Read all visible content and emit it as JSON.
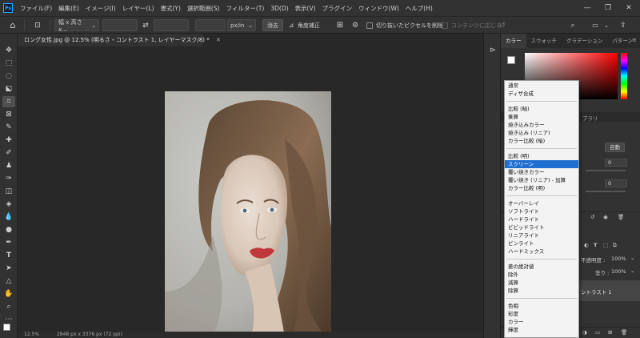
{
  "menubar": {
    "items": [
      "ファイル(F)",
      "編集(E)",
      "イメージ(I)",
      "レイヤー(L)",
      "書式(Y)",
      "選択範囲(S)",
      "フィルター(T)",
      "3D(D)",
      "表示(V)",
      "プラグイン",
      "ウィンドウ(W)",
      "ヘルプ(H)"
    ]
  },
  "optionsbar": {
    "ratio_value": "幅 x 高さ x...",
    "unit_value": "px/in",
    "clear_label": "消去",
    "straighten_label": "角度補正",
    "delete_cropped_label": "切り抜いたピクセルを削除",
    "content_aware_label": "コンテンツに応じる"
  },
  "document": {
    "tab_title": "ロング女性.jpg @ 12.5% (明るさ・コントラスト 1, レイヤーマスク/8) *"
  },
  "statusbar": {
    "zoom": "12.5%",
    "info": "2848 px x 3376 px (72 ppi)"
  },
  "panels": {
    "tabs": [
      "カラー",
      "スウォッチ",
      "グラデーション",
      "パターン"
    ],
    "adjust_tab_partial": "ブラリ",
    "auto_label": "自動",
    "value_1": "0",
    "value_2": "0",
    "opacity_label": "不透明度 :",
    "opacity_value": "100%",
    "fill_label": "塗り :",
    "fill_value": "100%",
    "layer_name_partial": "ントラスト 1"
  },
  "blend_modes": {
    "groups": [
      [
        "通常",
        "ディザ合成"
      ],
      [
        "比較 (暗)",
        "乗算",
        "焼き込みカラー",
        "焼き込み (リニア)",
        "カラー比較 (暗)"
      ],
      [
        "比較 (明)",
        "スクリーン",
        "覆い焼きカラー",
        "覆い焼き (リニア) - 加算",
        "カラー比較 (明)"
      ],
      [
        "オーバーレイ",
        "ソフトライト",
        "ハードライト",
        "ビビッドライト",
        "リニアライト",
        "ピンライト",
        "ハードミックス"
      ],
      [
        "差の絶対値",
        "除外",
        "減算",
        "除算"
      ],
      [
        "色相",
        "彩度",
        "カラー",
        "輝度"
      ]
    ],
    "selected": "スクリーン"
  },
  "colors": {
    "selection_blue": "#1e6fd0",
    "ui_dark": "#323232",
    "canvas_bg": "#282828",
    "lip_red": "#c0383c"
  }
}
